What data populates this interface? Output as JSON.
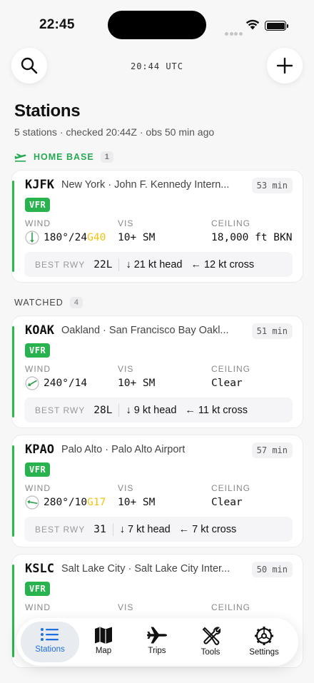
{
  "status": {
    "time": "22:45"
  },
  "header": {
    "utc": "20:44 UTC",
    "title": "Stations",
    "subtitle": "5 stations · checked 20:44Z · obs 50 min ago"
  },
  "sections": {
    "home": {
      "label": "HOME BASE",
      "count": "1"
    },
    "watched": {
      "label": "WATCHED",
      "count": "4"
    }
  },
  "labels": {
    "wind": "WIND",
    "vis": "VIS",
    "ceiling": "CEILING",
    "best_rwy": "BEST RWY"
  },
  "stations": [
    {
      "ident": "KJFK",
      "name": "New York · John F. Kennedy Intern...",
      "age": "53 min",
      "category": "VFR",
      "wind": "180°/24",
      "gust": "G40",
      "vis": "10+ SM",
      "ceiling": "18,000 ft BKN",
      "rwy": "22L",
      "headwind": "↓ 21 kt head",
      "crosswind": "← 12 kt cross"
    },
    {
      "ident": "KOAK",
      "name": "Oakland · San Francisco Bay Oakl...",
      "age": "51 min",
      "category": "VFR",
      "wind": "240°/14",
      "gust": "",
      "vis": "10+ SM",
      "ceiling": "Clear",
      "rwy": "28L",
      "headwind": "↓ 9 kt head",
      "crosswind": "← 11 kt cross"
    },
    {
      "ident": "KPAO",
      "name": "Palo Alto · Palo Alto Airport",
      "age": "57 min",
      "category": "VFR",
      "wind": "280°/10",
      "gust": "G17",
      "vis": "10+ SM",
      "ceiling": "Clear",
      "rwy": "31",
      "headwind": "↓ 7 kt head",
      "crosswind": "← 7 kt cross"
    },
    {
      "ident": "KSLC",
      "name": "Salt Lake City · Salt Lake City Inter...",
      "age": "50 min",
      "category": "VFR"
    }
  ],
  "tabs": [
    {
      "label": "Stations",
      "icon": "list-icon",
      "active": true
    },
    {
      "label": "Map",
      "icon": "map-icon"
    },
    {
      "label": "Trips",
      "icon": "airplane-icon"
    },
    {
      "label": "Tools",
      "icon": "tools-icon"
    },
    {
      "label": "Settings",
      "icon": "gear-icon"
    }
  ],
  "colors": {
    "accent": "#1f6fe0",
    "vfr": "#29b34f",
    "gust": "#f2c40d"
  }
}
